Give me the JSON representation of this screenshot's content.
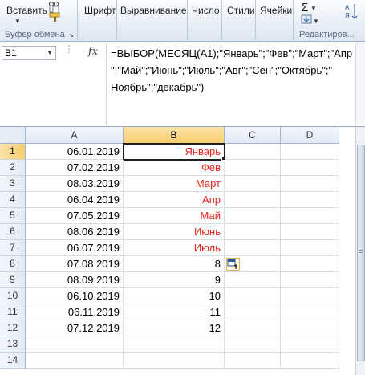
{
  "ribbon": {
    "clipboard": {
      "paste_label": "Вставить",
      "group_label": "Буфер обмена"
    },
    "font_label": "Шрифт",
    "alignment_label": "Выравнивание",
    "number_label": "Число",
    "styles_label": "Стили",
    "cells_label": "Ячейки",
    "editing_label": "Редактиров..."
  },
  "formula_bar": {
    "name_box": "B1",
    "fx_label": "fx",
    "formula": "=ВЫБОР(МЕСЯЦ(A1);\"Январь\";\"Фев\";\"Март\";\"Апр\";\"Май\";\"Июнь\";\"Июль\";\"Авг\";\"Сен\";\"Октябрь\";\" Ноябрь\";\"декабрь\")"
  },
  "sheet": {
    "columns": [
      "A",
      "B",
      "C",
      "D"
    ],
    "active_cell": "B1",
    "rows": [
      {
        "num": "1",
        "a": "06.01.2019",
        "b": "Январь"
      },
      {
        "num": "2",
        "a": "07.02.2019",
        "b": "Фев"
      },
      {
        "num": "3",
        "a": "08.03.2019",
        "b": "Март"
      },
      {
        "num": "4",
        "a": "06.04.2019",
        "b": "Апр"
      },
      {
        "num": "5",
        "a": "07.05.2019",
        "b": "Май"
      },
      {
        "num": "6",
        "a": "08.06.2019",
        "b": "Июнь"
      },
      {
        "num": "7",
        "a": "06.07.2019",
        "b": "Июль"
      },
      {
        "num": "8",
        "a": "07.08.2019",
        "b": "8"
      },
      {
        "num": "9",
        "a": "08.09.2019",
        "b": "9"
      },
      {
        "num": "10",
        "a": "06.10.2019",
        "b": "10"
      },
      {
        "num": "11",
        "a": "06.11.2019",
        "b": "11"
      },
      {
        "num": "12",
        "a": "07.12.2019",
        "b": "12"
      },
      {
        "num": "13",
        "a": "",
        "b": ""
      },
      {
        "num": "14",
        "a": "",
        "b": ""
      }
    ],
    "text_red": "#e2271c"
  }
}
